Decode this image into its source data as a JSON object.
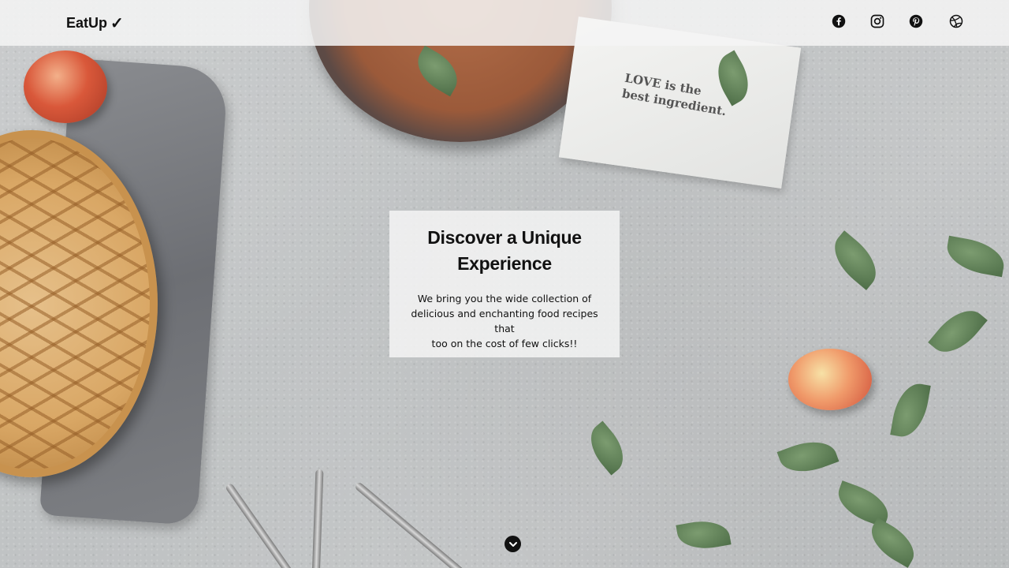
{
  "header": {
    "brand": "EatUp",
    "brand_mark": "✓",
    "social": [
      {
        "name": "facebook-icon"
      },
      {
        "name": "instagram-icon"
      },
      {
        "name": "pinterest-icon"
      },
      {
        "name": "dribbble-icon"
      }
    ]
  },
  "hero": {
    "title_line1": "Discover a Unique",
    "title_line2": "Experience",
    "text_line1": "We bring you the wide collection of",
    "text_line2": "delicious and enchanting food recipes that",
    "text_line3": "too on the cost of few clicks!!"
  },
  "background": {
    "napkin_line1": "LOVE is the",
    "napkin_line2": "best ingredient."
  },
  "scroll_button": {
    "icon": "chevron-down-icon"
  },
  "colors": {
    "header_bg": "#f5f5f5",
    "text": "#111111",
    "card_bg": "#f5f5f5"
  }
}
